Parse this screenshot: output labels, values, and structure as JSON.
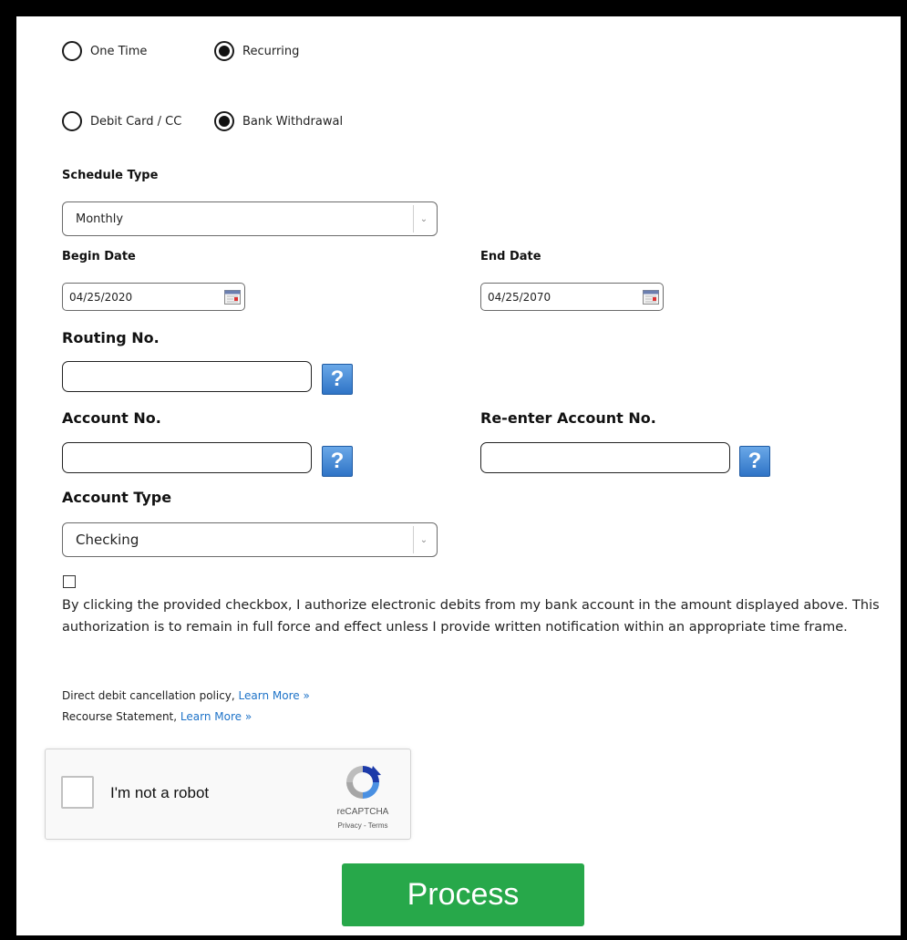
{
  "frequency": {
    "options": [
      {
        "label": "One Time",
        "selected": false
      },
      {
        "label": "Recurring",
        "selected": true
      }
    ]
  },
  "method": {
    "options": [
      {
        "label": "Debit Card / CC",
        "selected": false
      },
      {
        "label": "Bank Withdrawal",
        "selected": true
      }
    ]
  },
  "schedule": {
    "label": "Schedule Type",
    "value": "Monthly"
  },
  "begin_date": {
    "label": "Begin Date",
    "value": "04/25/2020"
  },
  "end_date": {
    "label": "End Date",
    "value": "04/25/2070"
  },
  "routing": {
    "label": "Routing No.",
    "value": "",
    "help": "?"
  },
  "account": {
    "label": "Account No.",
    "value": "",
    "help": "?"
  },
  "reenter_account": {
    "label": "Re-enter Account No.",
    "value": "",
    "help": "?"
  },
  "account_type": {
    "label": "Account Type",
    "value": "Checking"
  },
  "authorization": {
    "checked": false,
    "text": "By clicking the provided checkbox, I authorize electronic debits from my bank account in the amount displayed above. This authorization is to remain in full force and effect unless I provide written notification within an appropriate time frame."
  },
  "policies": {
    "cancellation_text": "Direct debit cancellation policy,",
    "recourse_text": "Recourse Statement,",
    "learn_more": "Learn More »"
  },
  "recaptcha": {
    "label": "I'm not a robot",
    "brand": "reCAPTCHA",
    "privacy": "Privacy",
    "separator": " - ",
    "terms": "Terms"
  },
  "process_button": "Process",
  "colors": {
    "accent_green": "#27a84a",
    "link_blue": "#1e73c8",
    "help_blue": "#2f74c6"
  }
}
